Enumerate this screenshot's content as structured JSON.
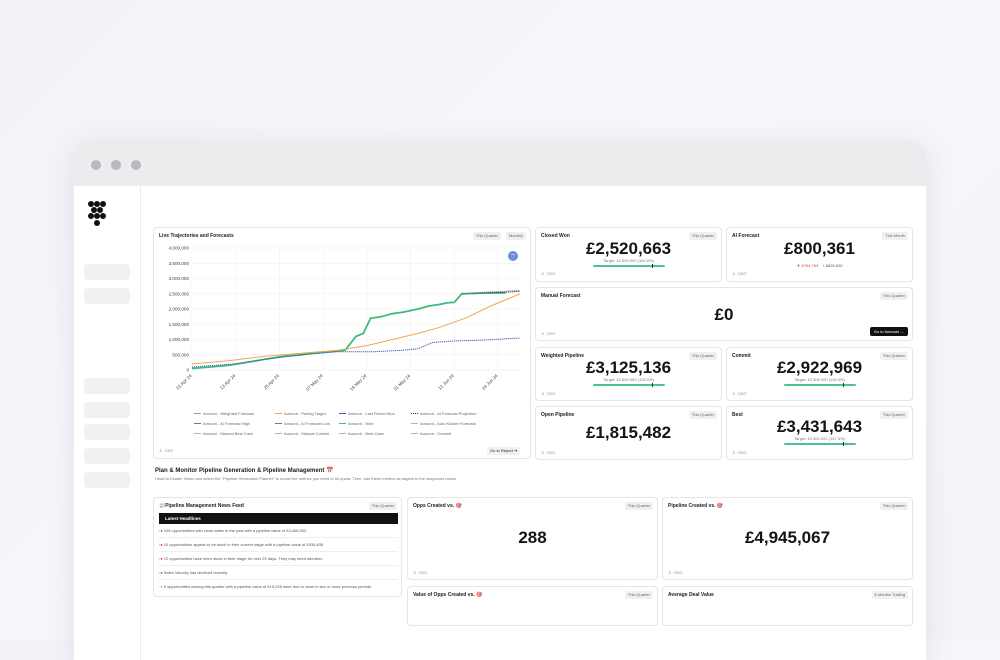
{
  "chart": {
    "title": "Live Trajectories and Forecasts",
    "chips": [
      "This Quarter",
      "Monthly"
    ],
    "owner": "CEO",
    "report_button": "Go to Report",
    "legend": [
      {
        "label": "Amount - Weighted Forecast",
        "color": "#9a9aa6",
        "dash": "solid"
      },
      {
        "label": "Amount - Pacing Target",
        "color": "#f2a64b",
        "dash": "solid"
      },
      {
        "label": "Amount - Last Period Won",
        "color": "#3a5fb8",
        "dash": "solid"
      },
      {
        "label": "Amount - AI Forecast Projection",
        "color": "#333333",
        "dash": "dotted"
      },
      {
        "label": "Amount - AI Forecast High",
        "color": "#777777",
        "dash": "solid"
      },
      {
        "label": "Amount - AI Forecast Low",
        "color": "#777777",
        "dash": "solid"
      },
      {
        "label": "Amount - Won",
        "color": "#3dbd7d",
        "dash": "solid"
      },
      {
        "label": "Amount - Auto Kluster Forecast",
        "color": "#b0b0b8",
        "dash": "solid"
      },
      {
        "label": "Amount - Manual Best Case",
        "color": "#b0b0b8",
        "dash": "solid"
      },
      {
        "label": "Amount - Manual Commit",
        "color": "#b0b0b8",
        "dash": "solid"
      },
      {
        "label": "Amount - Best Case",
        "color": "#b0b0b8",
        "dash": "solid"
      },
      {
        "label": "Amount - Commit",
        "color": "#b0b0b8",
        "dash": "solid"
      }
    ]
  },
  "chart_data": {
    "type": "line",
    "title": "Live Trajectories and Forecasts",
    "x_ticks": [
      "01 Apr 24",
      "13 Apr 24",
      "25 Apr 24",
      "07 May 24",
      "19 May 24",
      "31 May 24",
      "12 Jun 24",
      "24 Jun 24"
    ],
    "y_ticks": [
      "4,000,000",
      "3,500,000",
      "3,000,000",
      "2,500,000",
      "2,000,000",
      "1,500,000",
      "1,000,000",
      "500,000",
      "0"
    ],
    "ylim": [
      0,
      4000000
    ],
    "xlim": [
      0,
      90
    ],
    "grid": true,
    "legend_position": "bottom",
    "series": [
      {
        "name": "Amount - Won",
        "color": "#3dbd7d",
        "points": [
          [
            0,
            50000
          ],
          [
            5,
            100000
          ],
          [
            10,
            150000
          ],
          [
            15,
            250000
          ],
          [
            20,
            350000
          ],
          [
            25,
            450000
          ],
          [
            30,
            500000
          ],
          [
            33,
            550000
          ],
          [
            38,
            600000
          ],
          [
            42,
            650000
          ],
          [
            45,
            1100000
          ],
          [
            47,
            1200000
          ],
          [
            49,
            1700000
          ],
          [
            52,
            1750000
          ],
          [
            55,
            1850000
          ],
          [
            58,
            1900000
          ],
          [
            62,
            2000000
          ],
          [
            65,
            2100000
          ],
          [
            68,
            2150000
          ],
          [
            70,
            2200000
          ],
          [
            72,
            2220000
          ],
          [
            74,
            2500000
          ],
          [
            80,
            2520000
          ],
          [
            86,
            2530000
          ]
        ]
      },
      {
        "name": "Amount - Pacing Target",
        "color": "#f2a64b",
        "points": [
          [
            0,
            200000
          ],
          [
            10,
            300000
          ],
          [
            20,
            450000
          ],
          [
            30,
            550000
          ],
          [
            40,
            650000
          ],
          [
            48,
            800000
          ],
          [
            55,
            1000000
          ],
          [
            62,
            1200000
          ],
          [
            68,
            1400000
          ],
          [
            75,
            1700000
          ],
          [
            82,
            2100000
          ],
          [
            90,
            2500000
          ]
        ]
      },
      {
        "name": "Amount - Last Period Won",
        "color": "#3a5fb8",
        "points": [
          [
            0,
            100000
          ],
          [
            12,
            200000
          ],
          [
            20,
            350000
          ],
          [
            30,
            500000
          ],
          [
            40,
            600000
          ],
          [
            50,
            600000
          ],
          [
            58,
            650000
          ],
          [
            62,
            700000
          ],
          [
            66,
            900000
          ],
          [
            72,
            950000
          ],
          [
            80,
            980000
          ],
          [
            90,
            1050000
          ]
        ]
      },
      {
        "name": "Amount - AI Forecast Projection",
        "color": "#333333",
        "points": [
          [
            74,
            2500000
          ],
          [
            80,
            2530000
          ],
          [
            86,
            2550000
          ],
          [
            90,
            2580000
          ]
        ]
      },
      {
        "name": "Amount - AI Forecast High",
        "color": "#888888",
        "points": [
          [
            74,
            2500000
          ],
          [
            80,
            2550000
          ],
          [
            86,
            2580000
          ],
          [
            90,
            2620000
          ]
        ]
      }
    ]
  },
  "kpis": {
    "closed_won": {
      "title": "Closed Won",
      "chip": "This Quarter",
      "value": "£2,520,663",
      "target": "Target: £2,500,000 (100.8%)",
      "owner": "CEO",
      "progress": 1.0
    },
    "ai_forecast": {
      "title": "AI Forecast",
      "chip": "This Month",
      "value": "£800,361",
      "high": "▼ £764,763",
      "low": "+ £826,626",
      "owner": "CEO"
    },
    "manual_forecast": {
      "title": "Manual Forecast",
      "chip": "This Quarter",
      "value": "£0",
      "owner": "CEO",
      "button": "Go to forecast →"
    },
    "weighted_pipeline": {
      "title": "Weighted Pipeline",
      "chip": "This Quarter",
      "value": "£3,125,136",
      "target": "Target: £2,500,000 (125.0%)",
      "owner": "CEO",
      "progress": 1.0
    },
    "commit": {
      "title": "Commit",
      "chip": "This Quarter",
      "value": "£2,922,969",
      "target": "Target: £2,500,000 (116.9%)",
      "owner": "CEO",
      "progress": 1.0
    },
    "open_pipeline": {
      "title": "Open Pipeline",
      "chip": "This Quarter",
      "value": "£1,815,482",
      "owner": "CEO"
    },
    "best": {
      "title": "Best",
      "chip": "This Quarter",
      "value": "£3,431,643",
      "target": "Target: £2,500,000 (137.3%)",
      "owner": "CEO",
      "progress": 1.0
    }
  },
  "section": {
    "title": "Plan & Monitor Pipeline Generation & Pipeline Management 📅",
    "subtitle": "Head to Kluster Vision and select the \"Pipeline Generation Planner\" to model the metrics you need to hit quota. Then, add these metrics as targets to the snapshots below."
  },
  "news": {
    "title": "📰Pipeline Management News Feed",
    "chip": "This Quarter",
    "header": "Latest Headlines",
    "items": [
      "105 opportunities with close dates in the past with a pipeline value of £3,408,000",
      "10 opportunities appear to be stuck in their current stage with a pipeline value of £934,835",
      "12 opportunities have been stuck in their stage for over 20 days. They may need attention",
      "Sales Velocity has declined recently",
      "5 opportunities closing this quarter with a pipeline value of £15,225 were due to close in two or more previous periods"
    ]
  },
  "bottom_kpis": {
    "opps_created": {
      "title": "Opps Created vs. 🎯",
      "chip": "This Quarter",
      "value": "288",
      "owner": "CEO"
    },
    "pipeline_created": {
      "title": "Pipeline Created vs. 🎯",
      "chip": "This Quarter",
      "value": "£4,945,067",
      "owner": "CEO"
    },
    "value_opps_created": {
      "title": "Value of Opps Created vs. 🎯",
      "chip": "This Quarter"
    },
    "avg_deal_value": {
      "title": "Average Deal Value",
      "chip": "6 Months Trailing"
    }
  },
  "colors": {
    "accent_green": "#4cc38a",
    "dark": "#111111",
    "blue": "#6e8fe0"
  },
  "icons": [
    "grape-logo-icon",
    "user-icon",
    "arrow-right-icon",
    "zoom-icon"
  ]
}
